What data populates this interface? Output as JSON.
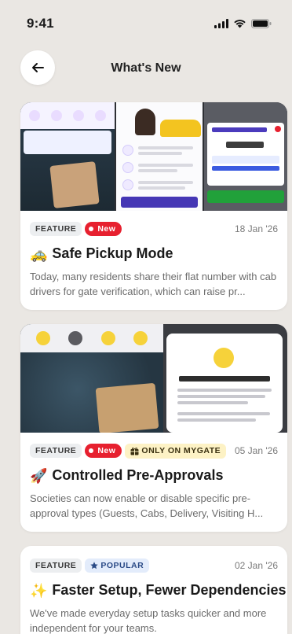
{
  "status_bar": {
    "time": "9:41"
  },
  "header": {
    "title": "What's New"
  },
  "feed": [
    {
      "tags": {
        "feature": "FEATURE",
        "new": "New"
      },
      "date": "18 Jan '26",
      "emoji": "🚕",
      "title": "Safe Pickup Mode",
      "description": "Today, many residents share their flat number with cab drivers for gate verification, which can raise pr..."
    },
    {
      "tags": {
        "feature": "FEATURE",
        "new": "New",
        "exclusive": "ONLY ON MYGATE"
      },
      "date": "05 Jan '26",
      "emoji": "🚀",
      "title": "Controlled Pre-Approvals",
      "description": "Societies can now enable or disable specific pre-approval types (Guests, Cabs, Delivery, Visiting H..."
    },
    {
      "tags": {
        "feature": "FEATURE",
        "popular": "POPULAR"
      },
      "date": "02 Jan '26",
      "emoji": "✨",
      "title": "Faster Setup, Fewer Dependencies!",
      "description": "We've made everyday setup tasks quicker and more independent for your teams."
    }
  ],
  "colors": {
    "background": "#eae7e3",
    "new_badge": "#e7202f",
    "mygate_badge": "#fdf2c5",
    "popular_badge": "#e3ecfb"
  },
  "icons": [
    "back-arrow-icon",
    "signal-icon",
    "wifi-icon",
    "battery-icon",
    "star-icon",
    "gift-icon"
  ]
}
